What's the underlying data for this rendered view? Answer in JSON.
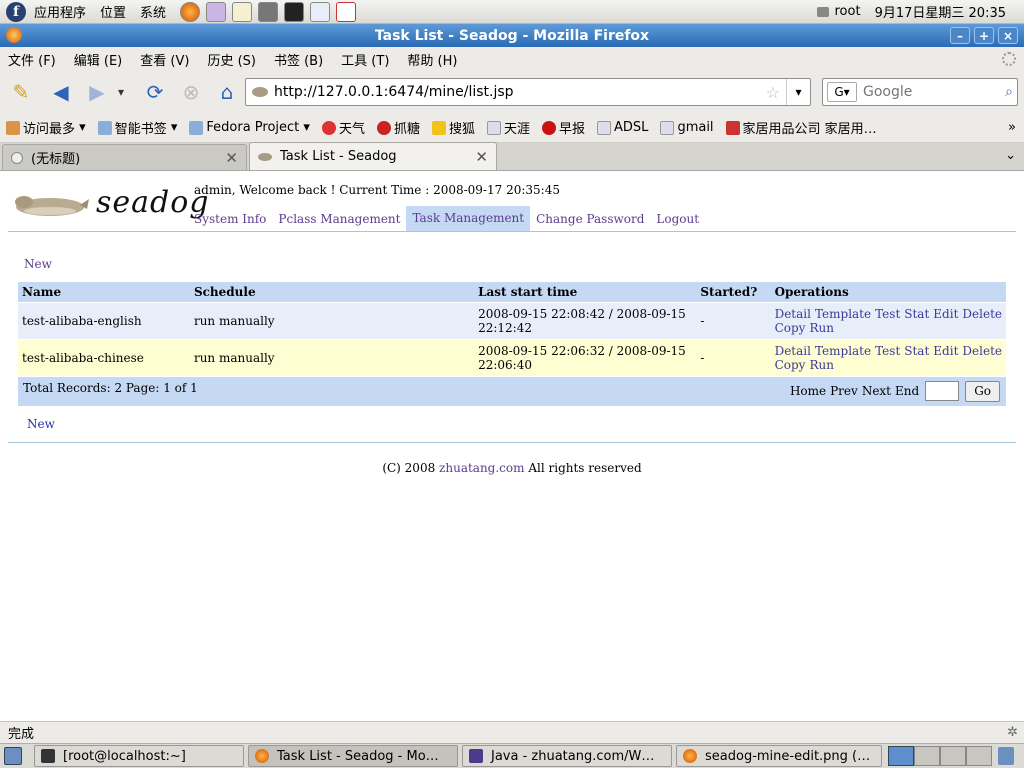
{
  "system_bar": {
    "menus": [
      "应用程序",
      "位置",
      "系统"
    ],
    "user": "root",
    "datetime": "9月17日星期三 20:35"
  },
  "window": {
    "title": "Task List - Seadog - Mozilla Firefox"
  },
  "menubar": {
    "items": [
      "文件 (F)",
      "编辑 (E)",
      "查看 (V)",
      "历史 (S)",
      "书签 (B)",
      "工具 (T)",
      "帮助 (H)"
    ]
  },
  "navbar": {
    "url": "http://127.0.0.1:6474/mine/list.jsp",
    "search_placeholder": "Google"
  },
  "bookmarks": [
    "访问最多",
    "智能书签",
    "Fedora Project",
    "天气",
    "抓糖",
    "搜狐",
    "天涯",
    "早报",
    "ADSL",
    "gmail",
    "家居用品公司 家居用…"
  ],
  "tabs": [
    {
      "label": "(无标题)"
    },
    {
      "label": "Task List - Seadog"
    }
  ],
  "page": {
    "logo_text": "seadog",
    "welcome": "admin, Welcome back ! Current Time : 2008-09-17 20:35:45",
    "nav": [
      "System Info",
      "Pclass Management",
      "Task Management",
      "Change Password",
      "Logout"
    ],
    "new_label": "New",
    "table": {
      "headers": [
        "Name",
        "Schedule",
        "Last start time",
        "Started?",
        "Operations"
      ],
      "rows": [
        {
          "name": "test-alibaba-english",
          "schedule": "run manually",
          "last_start": "2008-09-15 22:08:42 / 2008-09-15 22:12:42",
          "started": "-"
        },
        {
          "name": "test-alibaba-chinese",
          "schedule": "run manually",
          "last_start": "2008-09-15 22:06:32 / 2008-09-15 22:06:40",
          "started": "-"
        }
      ],
      "ops": [
        "Detail",
        "Template",
        "Test",
        "Stat",
        "Edit",
        "Delete",
        "Copy",
        "Run"
      ],
      "footer": "Total Records: 2 Page: 1 of 1",
      "pager": [
        "Home",
        "Prev",
        "Next",
        "End"
      ],
      "go_label": "Go"
    },
    "copyright_prefix": "(C) 2008",
    "copyright_link": "zhuatang.com",
    "copyright_suffix": "All rights reserved"
  },
  "status": {
    "text": "完成"
  },
  "taskbar": [
    {
      "label": "[root@localhost:~]"
    },
    {
      "label": "Task List - Seadog - Mo…"
    },
    {
      "label": "Java - zhuatang.com/W…"
    },
    {
      "label": "seadog-mine-edit.png (…"
    }
  ],
  "colors": {
    "title_bar": "#2a6bb6",
    "table_header": "#c5d9f5",
    "row_even": "#fffdd2",
    "link": "#5a3c8c"
  }
}
